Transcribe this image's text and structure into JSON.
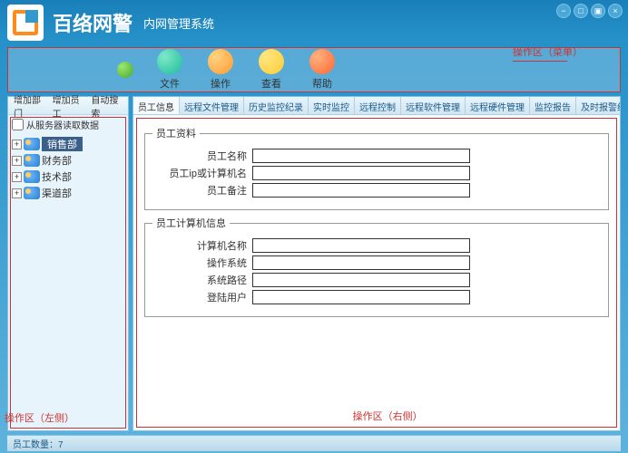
{
  "header": {
    "title_main": "百络网警",
    "title_sub": "内网管理系统"
  },
  "toolbar": {
    "items": [
      {
        "label": "文件"
      },
      {
        "label": "操作"
      },
      {
        "label": "查看"
      },
      {
        "label": "帮助"
      }
    ]
  },
  "annotations": {
    "menu": "操作区（菜单）",
    "left": "操作区（左侧）",
    "right": "操作区（右侧）"
  },
  "sidebar": {
    "buttons": {
      "add_dept": "增加部门",
      "add_emp": "增加员工",
      "auto_search": "自动搜索"
    },
    "checkbox_label": "从服务器读取数据",
    "tree": [
      {
        "label": "销售部",
        "selected": true
      },
      {
        "label": "财务部",
        "selected": false
      },
      {
        "label": "技术部",
        "selected": false
      },
      {
        "label": "渠道部",
        "selected": false
      }
    ]
  },
  "tabs": [
    "员工信息",
    "远程文件管理",
    "历史监控纪录",
    "实时监控",
    "远程控制",
    "远程软件管理",
    "远程硬件管理",
    "监控报告",
    "及时报警纪录"
  ],
  "active_tab": 0,
  "groups": {
    "g1": {
      "legend": "员工资料",
      "fields": {
        "name": {
          "label": "员工名称",
          "value": ""
        },
        "ip": {
          "label": "员工ip或计算机名",
          "value": ""
        },
        "note": {
          "label": "员工备注",
          "value": ""
        }
      }
    },
    "g2": {
      "legend": "员工计算机信息",
      "fields": {
        "pc": {
          "label": "计算机名称",
          "value": ""
        },
        "os": {
          "label": "操作系统",
          "value": ""
        },
        "path": {
          "label": "系统路径",
          "value": ""
        },
        "user": {
          "label": "登陆用户",
          "value": ""
        }
      }
    }
  },
  "statusbar": {
    "count_label": "员工数量：7"
  }
}
